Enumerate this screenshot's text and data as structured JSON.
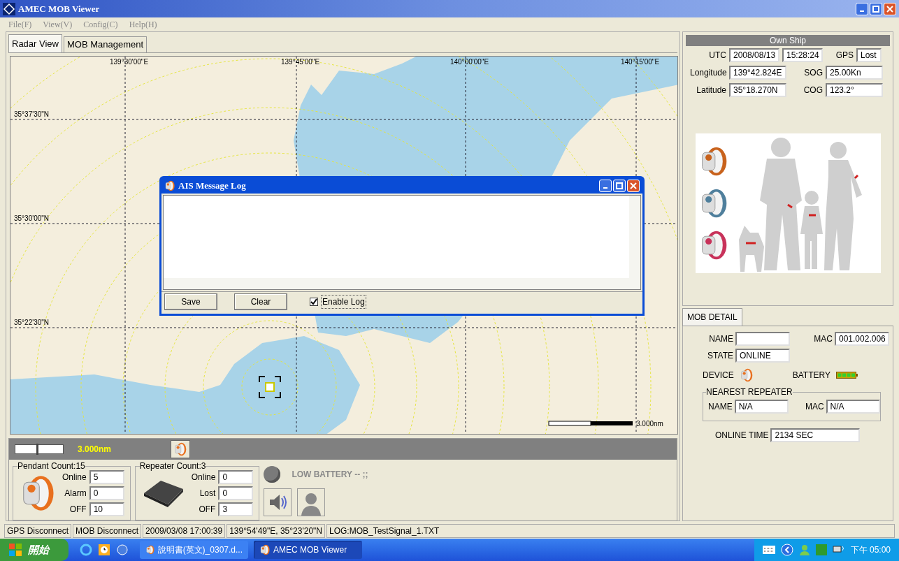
{
  "window": {
    "title": "AMEC MOB Viewer"
  },
  "menu": [
    "File(F)",
    "View(V)",
    "Config(C)",
    "Help(H)"
  ],
  "tabs": [
    {
      "label": "Radar View",
      "selected": true
    },
    {
      "label": "MOB Management",
      "selected": false
    }
  ],
  "map": {
    "lon_labels": [
      "139°30'00\"E",
      "139°45'00\"E",
      "140°00'00\"E",
      "140°15'00\"E"
    ],
    "lat_labels": [
      "35°37'30\"N",
      "35°30'00\"N",
      "35°22'30\"N"
    ],
    "scale_label": "3.000nm"
  },
  "dialog": {
    "title": "AIS Message Log",
    "buttons": [
      "Save",
      "Clear"
    ],
    "enable_log": {
      "label": "Enable Log",
      "checked": true
    }
  },
  "zoom_bar": {
    "level": 0.45,
    "range_label": "3.000nm"
  },
  "pendant": {
    "title": "Pendant Count:15",
    "rows": [
      {
        "label": "Online",
        "value": "5"
      },
      {
        "label": "Alarm",
        "value": "0"
      },
      {
        "label": "OFF",
        "value": "10"
      }
    ]
  },
  "repeater": {
    "title": "Repeater Count:3",
    "rows": [
      {
        "label": "Online",
        "value": "0"
      },
      {
        "label": "Lost",
        "value": "0"
      },
      {
        "label": "OFF",
        "value": "3"
      }
    ]
  },
  "alarm": {
    "label": "LOW BATTERY -- ;;"
  },
  "status_bar": [
    "GPS Disconnect",
    "MOB Disconnect",
    "2009/03/08 17:00:39",
    "139°54'49\"E, 35°23'20\"N",
    "LOG:MOB_TestSignal_1.TXT"
  ],
  "own_ship": {
    "title": "Own Ship",
    "utc_label": "UTC",
    "utc_date": "2008/08/13",
    "utc_time": "15:28:24",
    "gps_label": "GPS",
    "gps": "Lost",
    "longitude_label": "Longitude",
    "longitude": "139°42.824E",
    "sog_label": "SOG",
    "sog": "25.00Kn",
    "latitude_label": "Latitude",
    "latitude": "35°18.270N",
    "cog_label": "COG",
    "cog": "123.2°"
  },
  "mob_detail": {
    "tab": "MOB DETAIL",
    "name_label": "NAME",
    "mac_label": "MAC",
    "mac": "001.002.006",
    "state_label": "STATE",
    "state": "ONLINE",
    "device_label": "DEVICE",
    "battery_label": "BATTERY",
    "nearest_repeater": {
      "title": "NEAREST REPEATER",
      "name_label": "NAME",
      "name": "N/A",
      "mac_label": "MAC",
      "mac": "N/A"
    },
    "online_time_label": "ONLINE TIME",
    "online_time": "2134 SEC"
  },
  "taskbar": {
    "start": "開始",
    "tasks": [
      {
        "label": "說明書(英文)_0307.d...",
        "selected": false
      },
      {
        "label": "AMEC MOB Viewer",
        "selected": true
      }
    ],
    "clock": "下午 05:00"
  }
}
